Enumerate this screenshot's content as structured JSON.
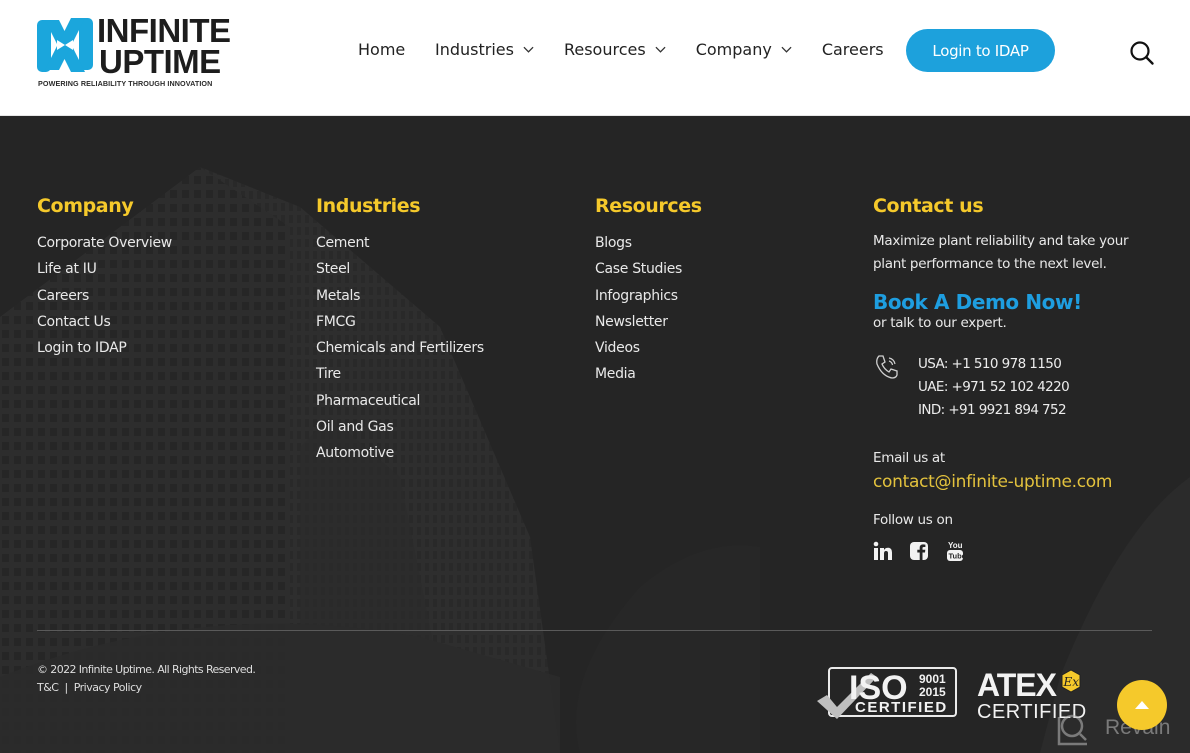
{
  "header": {
    "logo": {
      "line1": "INFINITE",
      "line2": "UPTIME",
      "tagline": "POWERING RELIABILITY THROUGH INNOVATION"
    },
    "nav": [
      {
        "label": "Home",
        "has_dropdown": false
      },
      {
        "label": "Industries",
        "has_dropdown": true
      },
      {
        "label": "Resources",
        "has_dropdown": true
      },
      {
        "label": "Company",
        "has_dropdown": true
      },
      {
        "label": "Careers",
        "has_dropdown": false
      }
    ],
    "login_button": "Login to IDAP",
    "search_icon": "search-icon"
  },
  "footer": {
    "company": {
      "title": "Company",
      "links": [
        "Corporate Overview",
        "Life at IU",
        "Careers",
        "Contact Us",
        "Login to IDAP"
      ]
    },
    "industries": {
      "title": "Industries",
      "links": [
        "Cement",
        "Steel",
        "Metals",
        "FMCG",
        "Chemicals and Fertilizers",
        "Tire",
        "Pharmaceutical",
        "Oil and Gas",
        "Automotive"
      ]
    },
    "resources": {
      "title": "Resources",
      "links": [
        "Blogs",
        "Case Studies",
        "Infographics",
        "Newsletter",
        "Videos",
        "Media"
      ]
    },
    "contact": {
      "title": "Contact us",
      "description": "Maximize plant reliability and take your plant performance to the next level.",
      "demo_link": "Book A Demo Now!",
      "expert_text": "or talk to our expert.",
      "phones": [
        "USA: +1 510 978 1150",
        "UAE: +971 52 102 4220",
        "IND: +91 9921 894 752"
      ],
      "email_label": "Email us at",
      "email": "contact@infinite-uptime.com",
      "follow_label": "Follow us on",
      "socials": [
        "linkedin-icon",
        "facebook-icon",
        "youtube-icon"
      ]
    },
    "copyright": "© 2022 Infinite Uptime. All Rights Reserved.",
    "legal": {
      "tc": "T&C",
      "separator": "|",
      "privacy": "Privacy Policy"
    },
    "certifications": {
      "iso": {
        "name": "ISO",
        "number": "9001",
        "year": "2015",
        "label": "CERTIFIED"
      },
      "atex": {
        "name": "ATEX",
        "mark": "Ex",
        "label": "CERTIFIED"
      }
    },
    "watermark": "Revain"
  },
  "colors": {
    "accent_yellow": "#f5c92b",
    "accent_blue": "#1da1dc",
    "footer_bg": "#252525",
    "header_bg": "#ffffff"
  }
}
